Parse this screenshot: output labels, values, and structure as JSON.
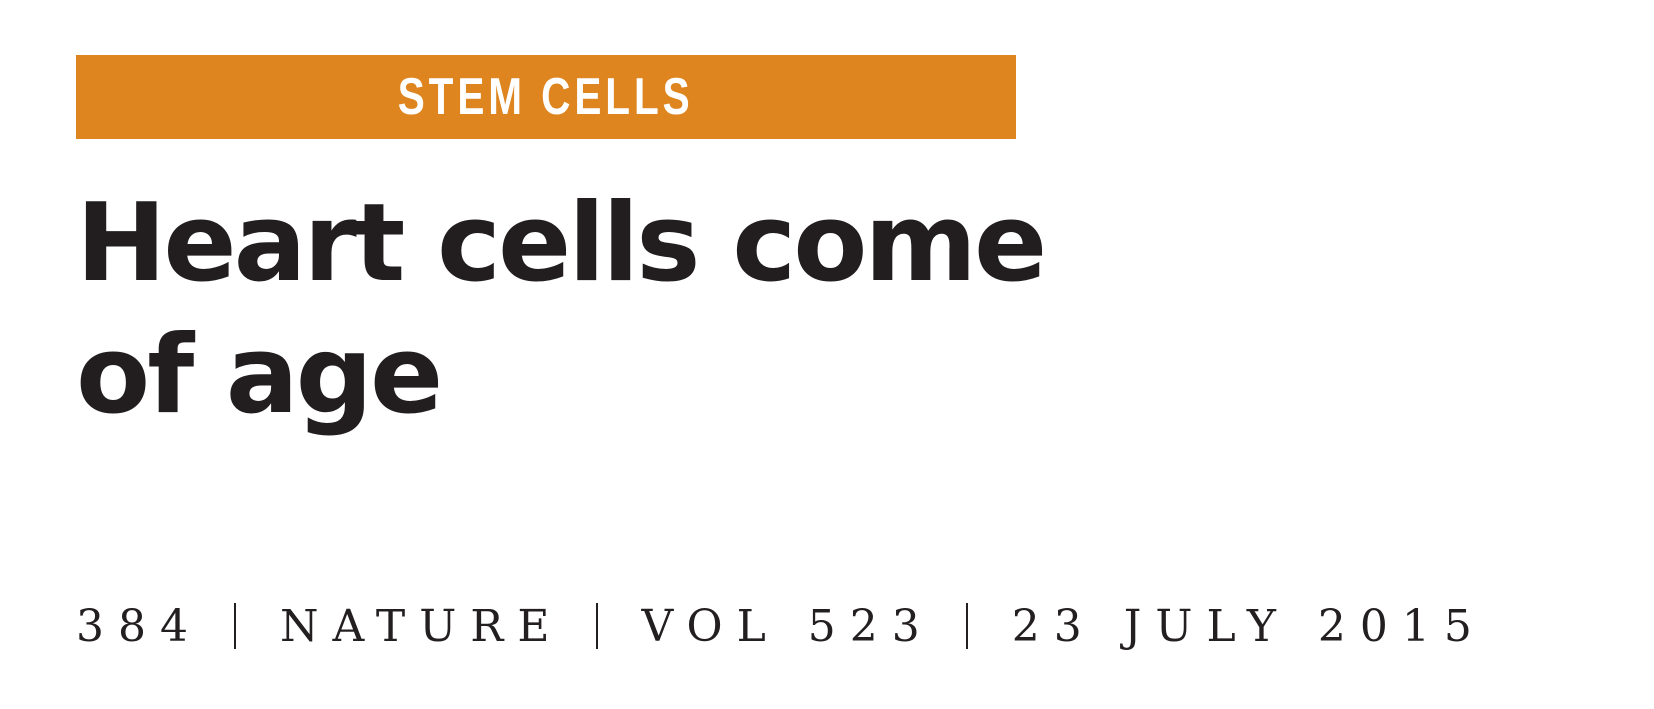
{
  "section": {
    "label": "STEM CELLS",
    "color": "#de851f"
  },
  "headline": {
    "line1": "Heart cells come",
    "line2": "of age"
  },
  "footer": {
    "page_number": "384",
    "journal": "NATURE",
    "volume": "VOL 523",
    "date": "23 JULY 2015"
  }
}
